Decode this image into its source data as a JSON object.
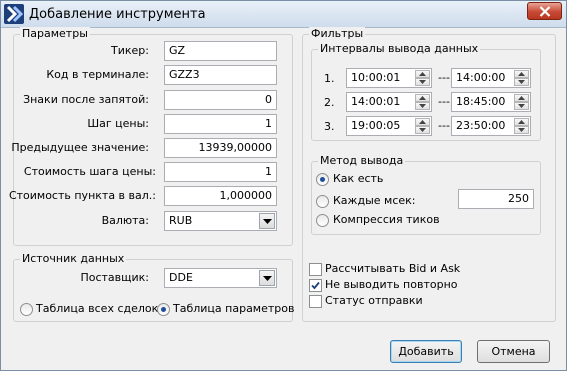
{
  "window": {
    "title": "Добавление инструмента"
  },
  "params": {
    "title": "Параметры",
    "ticker_label": "Тикер:",
    "ticker_value": "GZ",
    "term_code_label": "Код в терминале:",
    "term_code_value": "GZZ3",
    "decimals_label": "Знаки после запятой:",
    "decimals_value": "0",
    "step_label": "Шаг цены:",
    "step_value": "1",
    "prev_label": "Предыдущее значение:",
    "prev_value": "13939,00000",
    "step_cost_label": "Стоимость шага цены:",
    "step_cost_value": "1",
    "point_cost_label": "Стоимость пункта в вал.:",
    "point_cost_value": "1,000000",
    "currency_label": "Валюта:",
    "currency_value": "RUB"
  },
  "source": {
    "title": "Источник данных",
    "provider_label": "Поставщик:",
    "provider_value": "DDE",
    "radio_all_trades": "Таблица всех сделок",
    "radio_params_table": "Таблица параметров",
    "selected": "params_table"
  },
  "filters": {
    "title": "Фильтры",
    "intervals": {
      "title": "Интервалы вывода данных",
      "rows": [
        {
          "num": "1.",
          "from": "10:00:01",
          "sep": "---",
          "to": "14:00:00"
        },
        {
          "num": "2.",
          "from": "14:00:01",
          "sep": "---",
          "to": "18:45:00"
        },
        {
          "num": "3.",
          "from": "19:00:05",
          "sep": "---",
          "to": "23:50:00"
        }
      ]
    },
    "method": {
      "title": "Метод вывода",
      "as_is": "Как есть",
      "every_ms": "Каждые мсек:",
      "every_ms_value": "250",
      "compress": "Компрессия тиков",
      "selected": "as_is"
    },
    "checks": {
      "bid_ask": {
        "label": "Рассчитывать Bid и Ask",
        "checked": false
      },
      "no_repeat": {
        "label": "Не выводить повторно",
        "checked": true
      },
      "send_status": {
        "label": "Статус отправки",
        "checked": false
      }
    }
  },
  "buttons": {
    "add": "Добавить",
    "cancel": "Отмена"
  },
  "colors": {
    "title_bar_top": "#e9f0f8",
    "close_red": "#c74a36",
    "radio_dot": "#1f4f9c",
    "app_icon": "#1c3f7a"
  }
}
